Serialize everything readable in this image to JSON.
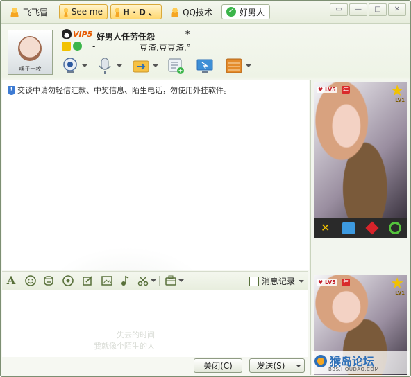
{
  "tabs": [
    {
      "label": "飞飞冒"
    },
    {
      "label": "See me"
    },
    {
      "label": "H · D 、"
    },
    {
      "label": "QQ技术"
    },
    {
      "label": "好男人"
    }
  ],
  "window_controls": {
    "pin": "▭",
    "min": "—",
    "max": "□",
    "close": "✕"
  },
  "contact": {
    "avatar_caption": "嘿子一枚",
    "vip_badge": "VIP5",
    "nickname": "好男人任劳任怨",
    "nickname_mark": "*",
    "dash": "-",
    "signature": "豆渣.豆豆渣.°"
  },
  "notice": {
    "text": "交谈中请勿轻信汇款、中奖信息、陌生电话，勿使用外挂软件。"
  },
  "toolbar_icons": [
    "video-call-icon",
    "voice-call-icon",
    "file-transfer-icon",
    "send-sms-icon",
    "remote-assist-icon",
    "app-box-icon"
  ],
  "format_toolbar": {
    "font": "A",
    "history_label": "消息记录"
  },
  "input_ghost": {
    "line1": "失去的时间",
    "line2": "我就像个陌生的人"
  },
  "buttons": {
    "close": "关闭(C)",
    "send": "发送(S)"
  },
  "right_panel": {
    "top_badge_level": "LV5",
    "top_badge_year": "年",
    "star_level": "LV1",
    "forum_text": "猴岛论坛",
    "forum_url": "BBS.HOUDAO.COM"
  },
  "colors": {
    "accent_green": "#58703a",
    "tab_highlight": "#ffd870",
    "vip_orange": "#e65a00"
  }
}
